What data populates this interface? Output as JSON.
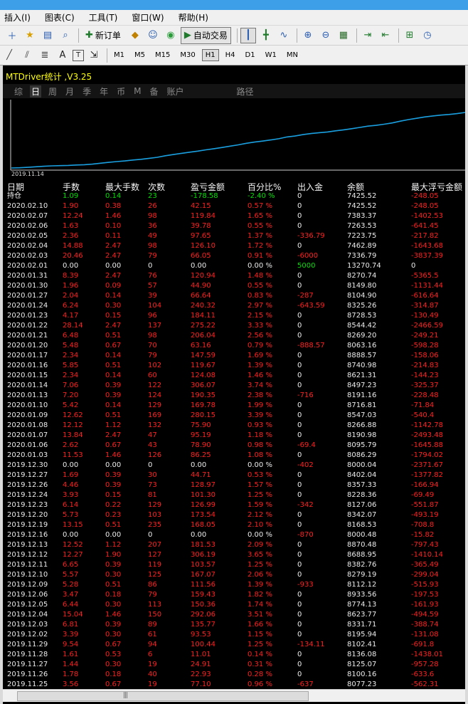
{
  "menu": [
    "插入(I)",
    "图表(C)",
    "工具(T)",
    "窗口(W)",
    "帮助(H)"
  ],
  "toolbar": {
    "new_order": "新订单",
    "auto_trade": "自动交易"
  },
  "timeframes": [
    "M1",
    "M5",
    "M15",
    "M30",
    "H1",
    "H4",
    "D1",
    "W1",
    "MN"
  ],
  "active_timeframe": "H1",
  "draw_tools": {
    "text_tool": "A",
    "label_tool": "T"
  },
  "panel": {
    "title": "MTDriver统计 ,V3.25",
    "tabs": [
      "综",
      "日",
      "周",
      "月",
      "季",
      "年",
      "币",
      "M",
      "备",
      "账户",
      "路径"
    ],
    "active_tab": "日",
    "chart_start_label": "2019.11.14"
  },
  "chart_data": {
    "type": "line",
    "title": "",
    "xlabel": "",
    "ylabel": "",
    "x_start_label": "2019.11.14",
    "line_color": "#1aa0e0",
    "values": [
      1.0,
      1.4,
      2.2,
      3.1,
      4.0,
      4.8,
      5.2,
      5.6,
      6.3,
      6.9,
      7.8,
      9.5,
      11.0,
      12.4,
      13.6,
      15.2,
      16.5,
      18.2,
      20.0,
      22.8,
      25.0,
      27.2,
      29.2,
      31.1,
      33.4,
      35.4,
      37.6,
      40.0,
      42.3,
      45.1,
      47.2,
      49.0,
      51.0,
      53.2,
      56.4,
      58.0,
      60.5,
      62.4,
      64.0,
      65.2,
      67.3,
      69.0,
      71.1,
      73.4,
      75.6,
      77.0,
      79.1,
      81.4,
      84.5,
      87.3,
      89.6,
      92.0,
      93.8,
      95.3,
      96.5,
      98.0,
      100.0
    ]
  },
  "table": {
    "columns": [
      "日期",
      "手数",
      "最大手数",
      "次数",
      "盈亏金额",
      "百分比%",
      "出入金",
      "余额",
      "最大浮亏金额"
    ],
    "colors": {
      "pos": "#00e000",
      "neg": "#ff2020",
      "neutral": "#ececec"
    },
    "rows": [
      [
        "持仓",
        "1.09",
        "0.14",
        "23",
        "-178.58",
        "-2.40 %",
        "0",
        "7425.52",
        "-248.05"
      ],
      [
        "2020.02.10",
        "1.90",
        "0.38",
        "26",
        "42.15",
        "0.57 %",
        "0",
        "7425.52",
        "-248.05"
      ],
      [
        "2020.02.07",
        "12.24",
        "1.46",
        "98",
        "119.84",
        "1.65 %",
        "0",
        "7383.37",
        "-1402.53"
      ],
      [
        "2020.02.06",
        "1.63",
        "0.10",
        "36",
        "39.78",
        "0.55 %",
        "0",
        "7263.53",
        "-641.45"
      ],
      [
        "2020.02.05",
        "2.36",
        "0.11",
        "49",
        "97.65",
        "1.37 %",
        "-336.79",
        "7223.75",
        "-217.82"
      ],
      [
        "2020.02.04",
        "14.88",
        "2.47",
        "98",
        "126.10",
        "1.72 %",
        "0",
        "7462.89",
        "-1643.68"
      ],
      [
        "2020.02.03",
        "20.46",
        "2.47",
        "79",
        "66.05",
        "0.91 %",
        "-6000",
        "7336.79",
        "-3837.39"
      ],
      [
        "2020.02.01",
        "0.00",
        "0.00",
        "0",
        "0.00",
        "0.00 %",
        "5000",
        "13270.74",
        "0"
      ],
      [
        "2020.01.31",
        "8.39",
        "2.47",
        "76",
        "120.94",
        "1.48 %",
        "0",
        "8270.74",
        "-5365.5"
      ],
      [
        "2020.01.30",
        "1.96",
        "0.09",
        "57",
        "44.90",
        "0.55 %",
        "0",
        "8149.80",
        "-1131.44"
      ],
      [
        "2020.01.27",
        "2.04",
        "0.14",
        "39",
        "66.64",
        "0.83 %",
        "-287",
        "8104.90",
        "-616.64"
      ],
      [
        "2020.01.24",
        "6.24",
        "0.30",
        "104",
        "240.32",
        "2.97 %",
        "-643.59",
        "8325.26",
        "-314.87"
      ],
      [
        "2020.01.23",
        "4.17",
        "0.15",
        "96",
        "184.11",
        "2.15 %",
        "0",
        "8728.53",
        "-130.49"
      ],
      [
        "2020.01.22",
        "28.14",
        "2.47",
        "137",
        "275.22",
        "3.33 %",
        "0",
        "8544.42",
        "-2466.59"
      ],
      [
        "2020.01.21",
        "6.48",
        "0.51",
        "98",
        "206.04",
        "2.56 %",
        "0",
        "8269.20",
        "-249.21"
      ],
      [
        "2020.01.20",
        "5.48",
        "0.67",
        "70",
        "63.16",
        "0.79 %",
        "-888.57",
        "8063.16",
        "-598.28"
      ],
      [
        "2020.01.17",
        "2.34",
        "0.14",
        "79",
        "147.59",
        "1.69 %",
        "0",
        "8888.57",
        "-158.06"
      ],
      [
        "2020.01.16",
        "5.85",
        "0.51",
        "102",
        "119.67",
        "1.39 %",
        "0",
        "8740.98",
        "-214.83"
      ],
      [
        "2020.01.15",
        "2.34",
        "0.14",
        "60",
        "124.08",
        "1.46 %",
        "0",
        "8621.31",
        "-144.23"
      ],
      [
        "2020.01.14",
        "7.06",
        "0.39",
        "122",
        "306.07",
        "3.74 %",
        "0",
        "8497.23",
        "-325.37"
      ],
      [
        "2020.01.13",
        "7.20",
        "0.39",
        "124",
        "190.35",
        "2.38 %",
        "-716",
        "8191.16",
        "-228.48"
      ],
      [
        "2020.01.10",
        "5.42",
        "0.14",
        "129",
        "169.78",
        "1.99 %",
        "0",
        "8716.81",
        "-71.84"
      ],
      [
        "2020.01.09",
        "12.62",
        "0.51",
        "169",
        "280.15",
        "3.39 %",
        "0",
        "8547.03",
        "-540.4"
      ],
      [
        "2020.01.08",
        "12.12",
        "1.12",
        "132",
        "75.90",
        "0.93 %",
        "0",
        "8266.88",
        "-1142.78"
      ],
      [
        "2020.01.07",
        "13.84",
        "2.47",
        "47",
        "95.19",
        "1.18 %",
        "0",
        "8190.98",
        "-2493.48"
      ],
      [
        "2020.01.06",
        "2.62",
        "0.67",
        "43",
        "78.90",
        "0.98 %",
        "-69.4",
        "8095.79",
        "-1645.88"
      ],
      [
        "2020.01.03",
        "11.53",
        "1.46",
        "126",
        "86.25",
        "1.08 %",
        "0",
        "8086.29",
        "-1794.02"
      ],
      [
        "2019.12.30",
        "0.00",
        "0.00",
        "0",
        "0.00",
        "0.00 %",
        "-402",
        "8000.04",
        "-2371.67"
      ],
      [
        "2019.12.27",
        "1.69",
        "0.39",
        "30",
        "44.71",
        "0.53 %",
        "0",
        "8402.04",
        "-1377.82"
      ],
      [
        "2019.12.26",
        "4.46",
        "0.39",
        "73",
        "128.97",
        "1.57 %",
        "0",
        "8357.33",
        "-166.94"
      ],
      [
        "2019.12.24",
        "3.93",
        "0.15",
        "81",
        "101.30",
        "1.25 %",
        "0",
        "8228.36",
        "-69.49"
      ],
      [
        "2019.12.23",
        "6.14",
        "0.22",
        "129",
        "126.99",
        "1.59 %",
        "-342",
        "8127.06",
        "-551.87"
      ],
      [
        "2019.12.20",
        "5.73",
        "0.23",
        "103",
        "173.54",
        "2.12 %",
        "0",
        "8342.07",
        "-493.19"
      ],
      [
        "2019.12.19",
        "13.15",
        "0.51",
        "235",
        "168.05",
        "2.10 %",
        "0",
        "8168.53",
        "-708.8"
      ],
      [
        "2019.12.16",
        "0.00",
        "0.00",
        "0",
        "0.00",
        "0.00 %",
        "-870",
        "8000.48",
        "-15.82"
      ],
      [
        "2019.12.13",
        "12.52",
        "1.12",
        "207",
        "181.53",
        "2.09 %",
        "0",
        "8870.48",
        "-797.43"
      ],
      [
        "2019.12.12",
        "12.27",
        "1.90",
        "127",
        "306.19",
        "3.65 %",
        "0",
        "8688.95",
        "-1410.14"
      ],
      [
        "2019.12.11",
        "6.65",
        "0.39",
        "119",
        "103.57",
        "1.25 %",
        "0",
        "8382.76",
        "-365.49"
      ],
      [
        "2019.12.10",
        "5.57",
        "0.30",
        "125",
        "167.07",
        "2.06 %",
        "0",
        "8279.19",
        "-299.04"
      ],
      [
        "2019.12.09",
        "5.28",
        "0.51",
        "86",
        "111.56",
        "1.39 %",
        "-933",
        "8112.12",
        "-515.93"
      ],
      [
        "2019.12.06",
        "3.47",
        "0.18",
        "79",
        "159.43",
        "1.82 %",
        "0",
        "8933.56",
        "-197.53"
      ],
      [
        "2019.12.05",
        "6.44",
        "0.30",
        "113",
        "150.36",
        "1.74 %",
        "0",
        "8774.13",
        "-161.93"
      ],
      [
        "2019.12.04",
        "15.04",
        "1.46",
        "150",
        "292.06",
        "3.51 %",
        "0",
        "8623.77",
        "-494.59"
      ],
      [
        "2019.12.03",
        "6.81",
        "0.39",
        "89",
        "135.77",
        "1.66 %",
        "0",
        "8331.71",
        "-388.74"
      ],
      [
        "2019.12.02",
        "3.39",
        "0.30",
        "61",
        "93.53",
        "1.15 %",
        "0",
        "8195.94",
        "-131.08"
      ],
      [
        "2019.11.29",
        "9.54",
        "0.67",
        "94",
        "100.44",
        "1.25 %",
        "-134.11",
        "8102.41",
        "-691.8"
      ],
      [
        "2019.11.28",
        "1.61",
        "0.53",
        "6",
        "11.01",
        "0.14 %",
        "0",
        "8136.08",
        "-1438.01"
      ],
      [
        "2019.11.27",
        "1.44",
        "0.30",
        "19",
        "24.91",
        "0.31 %",
        "0",
        "8125.07",
        "-957.28"
      ],
      [
        "2019.11.26",
        "1.78",
        "0.18",
        "40",
        "22.93",
        "0.28 %",
        "0",
        "8100.16",
        "-633.6"
      ],
      [
        "2019.11.25",
        "3.56",
        "0.67",
        "19",
        "77.10",
        "0.96 %",
        "-637",
        "8077.23",
        "-562.31"
      ]
    ]
  }
}
